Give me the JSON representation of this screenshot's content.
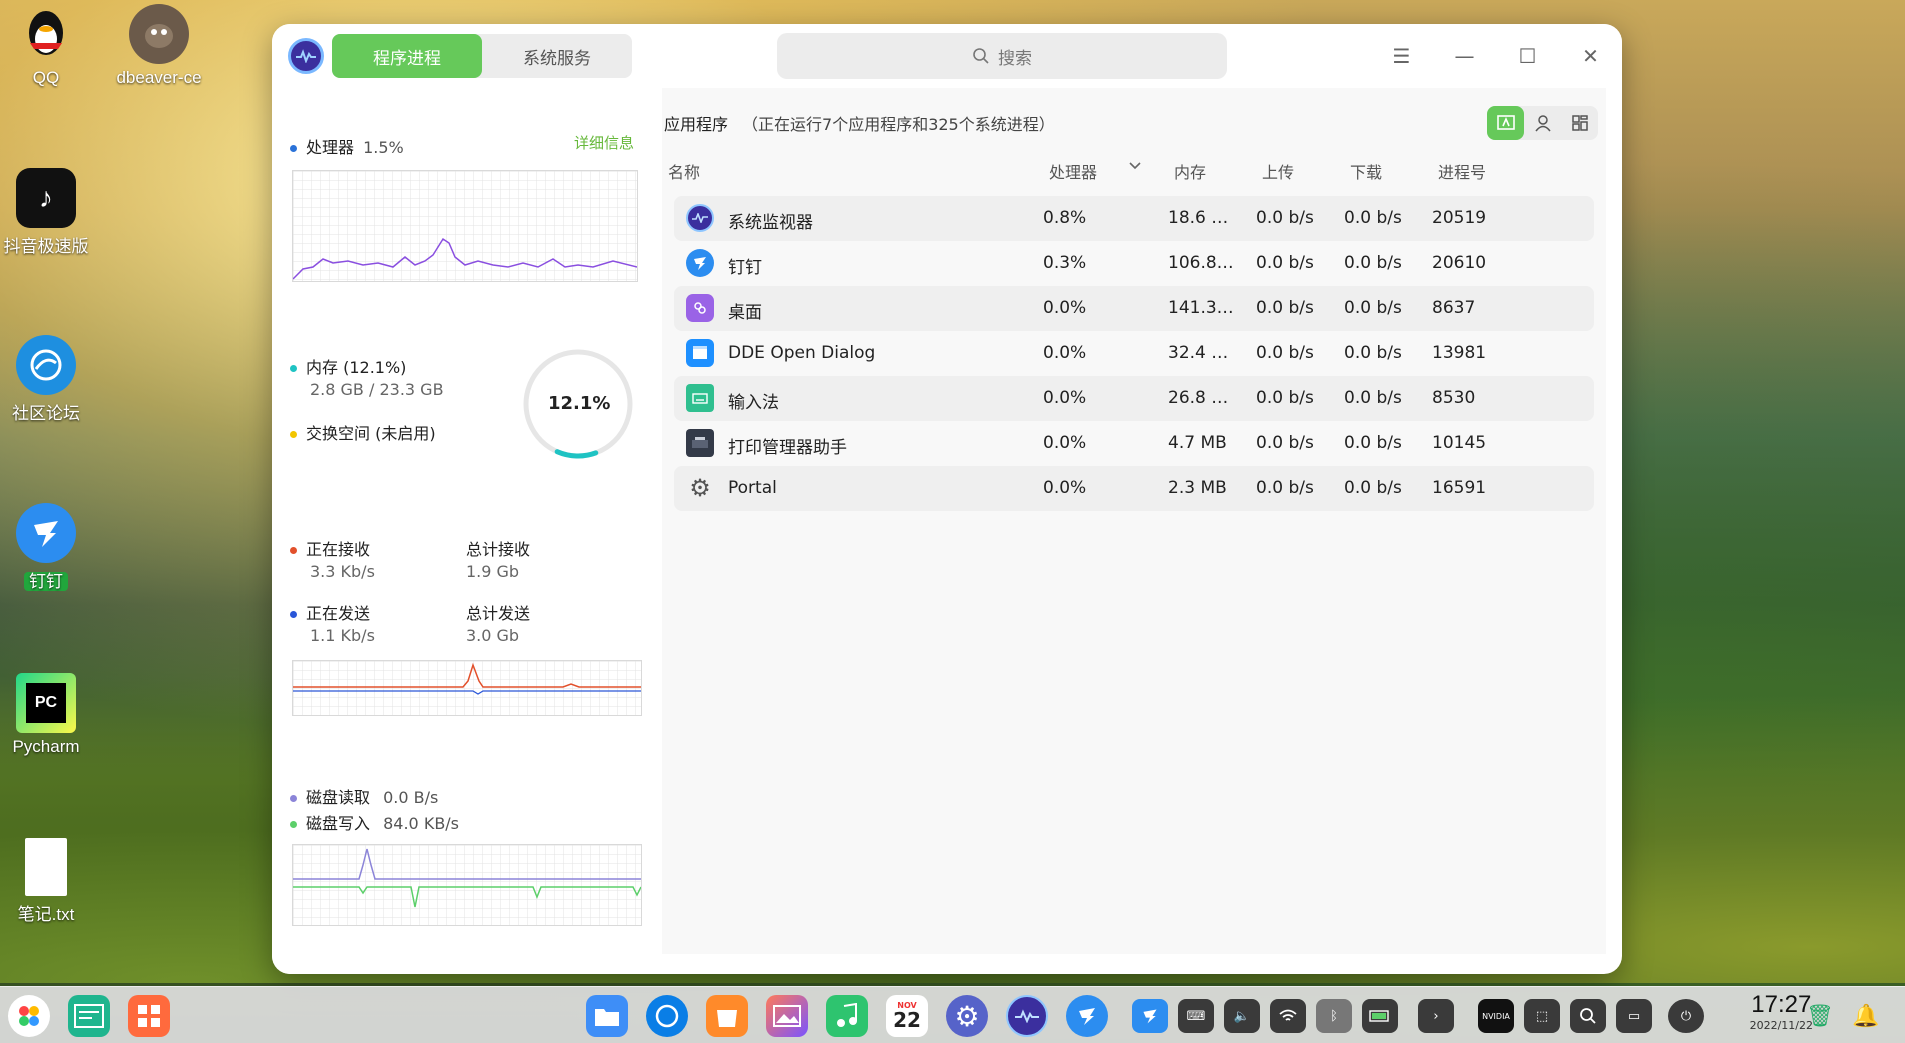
{
  "desktop": {
    "icons": [
      {
        "label": "QQ"
      },
      {
        "label": "dbeaver-ce"
      },
      {
        "label": "抖音极速版"
      },
      {
        "label": "社区论坛"
      },
      {
        "label": "钉钉"
      },
      {
        "label": "Pycharm"
      },
      {
        "label": "笔记.txt"
      }
    ]
  },
  "window": {
    "tabs": [
      {
        "label": "程序进程",
        "active": true
      },
      {
        "label": "系统服务",
        "active": false
      }
    ],
    "search": {
      "placeholder": "搜索"
    },
    "controls": {
      "menu": "☰",
      "minimize": "—",
      "maximize": "☐",
      "close": "✕"
    }
  },
  "left": {
    "cpu": {
      "label": "处理器",
      "value": "1.5%",
      "detail_link": "详细信息",
      "color": "#2a72d8"
    },
    "memory": {
      "label": "内存 (12.1%)",
      "usage": "2.8 GB / 23.3 GB",
      "ring_value": "12.1%",
      "fraction": 0.121,
      "color": "#1fc3c3"
    },
    "swap": {
      "label": "交换空间 (未启用)",
      "color": "#f2c500"
    },
    "network": {
      "receiving_label": "正在接收",
      "receiving_value": "3.3 Kb/s",
      "total_recv_label": "总计接收",
      "total_recv_value": "1.9 Gb",
      "sending_label": "正在发送",
      "sending_value": "1.1 Kb/s",
      "total_sent_label": "总计发送",
      "total_sent_value": "3.0 Gb",
      "recv_color": "#e2502b",
      "send_color": "#2a56d8"
    },
    "disk": {
      "read_label": "磁盘读取",
      "read_value": "0.0 B/s",
      "write_label": "磁盘写入",
      "write_value": "84.0 KB/s",
      "read_color": "#8b84d8",
      "write_color": "#5ccf6a"
    }
  },
  "right": {
    "title": "应用程序",
    "note": "（正在运行7个应用程序和325个系统进程）",
    "columns": {
      "name": "名称",
      "cpu": "处理器",
      "memory": "内存",
      "upload": "上传",
      "download": "下载",
      "pid": "进程号"
    },
    "rows": [
      {
        "name": "系统监视器",
        "cpu": "0.8%",
        "memory": "18.6 …",
        "upload": "0.0 b/s",
        "download": "0.0 b/s",
        "pid": "20519",
        "icon": "monitor-icon",
        "icon_color": "#3b2f9e"
      },
      {
        "name": "钉钉",
        "cpu": "0.3%",
        "memory": "106.8…",
        "upload": "0.0 b/s",
        "download": "0.0 b/s",
        "pid": "20610",
        "icon": "dingtalk-icon",
        "icon_color": "#2c8df0"
      },
      {
        "name": "桌面",
        "cpu": "0.0%",
        "memory": "141.3…",
        "upload": "0.0 b/s",
        "download": "0.0 b/s",
        "pid": "8637",
        "icon": "desktop-icon",
        "icon_color": "#9a63e6"
      },
      {
        "name": "DDE Open Dialog",
        "cpu": "0.0%",
        "memory": "32.4 …",
        "upload": "0.0 b/s",
        "download": "0.0 b/s",
        "pid": "13981",
        "icon": "dialog-icon",
        "icon_color": "#1e90ff"
      },
      {
        "name": "输入法",
        "cpu": "0.0%",
        "memory": "26.8 …",
        "upload": "0.0 b/s",
        "download": "0.0 b/s",
        "pid": "8530",
        "icon": "keyboard-icon",
        "icon_color": "#2fbf8f"
      },
      {
        "name": "打印管理器助手",
        "cpu": "0.0%",
        "memory": "4.7 MB",
        "upload": "0.0 b/s",
        "download": "0.0 b/s",
        "pid": "10145",
        "icon": "printer-icon",
        "icon_color": "#333a48"
      },
      {
        "name": "Portal",
        "cpu": "0.0%",
        "memory": "2.3 MB",
        "upload": "0.0 b/s",
        "download": "0.0 b/s",
        "pid": "16591",
        "icon": "gear-icon",
        "icon_color": "#555555"
      }
    ]
  },
  "dock": {
    "calendar_day": "22",
    "calendar_month": "NOV",
    "clock_time": "17:27",
    "clock_date": "2022/11/22"
  }
}
